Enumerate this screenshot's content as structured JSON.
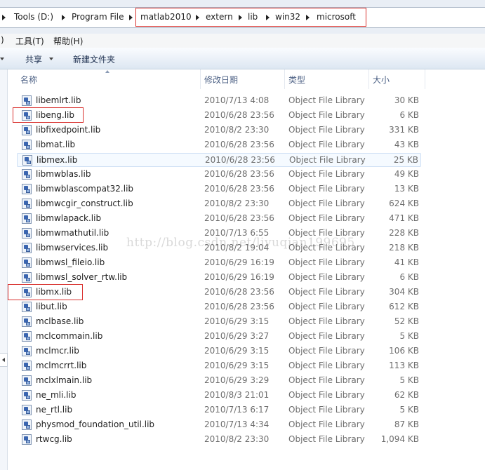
{
  "address_bar": {
    "crumbs": [
      "Tools (D:)",
      "Program File",
      "matlab2010",
      "extern",
      "lib",
      "win32",
      "microsoft"
    ]
  },
  "menu": {
    "items": [
      {
        "label": ")"
      },
      {
        "label": "工具(T)"
      },
      {
        "label": "帮助(H)"
      }
    ]
  },
  "toolbar": {
    "share_label": "共享",
    "new_folder_label": "新建文件夹"
  },
  "columns": {
    "name": "名称",
    "date": "修改日期",
    "type": "类型",
    "size": "大小"
  },
  "files": [
    {
      "name": "libemlrt.lib",
      "date": "2010/7/13 4:08",
      "type": "Object File Library",
      "size": "30 KB"
    },
    {
      "name": "libeng.lib",
      "date": "2010/6/28 23:56",
      "type": "Object File Library",
      "size": "6 KB"
    },
    {
      "name": "libfixedpoint.lib",
      "date": "2010/8/2 23:30",
      "type": "Object File Library",
      "size": "331 KB"
    },
    {
      "name": "libmat.lib",
      "date": "2010/6/28 23:56",
      "type": "Object File Library",
      "size": "43 KB"
    },
    {
      "name": "libmex.lib",
      "date": "2010/6/28 23:56",
      "type": "Object File Library",
      "size": "25 KB"
    },
    {
      "name": "libmwblas.lib",
      "date": "2010/6/28 23:56",
      "type": "Object File Library",
      "size": "49 KB"
    },
    {
      "name": "libmwblascompat32.lib",
      "date": "2010/6/28 23:56",
      "type": "Object File Library",
      "size": "13 KB"
    },
    {
      "name": "libmwcgir_construct.lib",
      "date": "2010/8/2 23:30",
      "type": "Object File Library",
      "size": "624 KB"
    },
    {
      "name": "libmwlapack.lib",
      "date": "2010/6/28 23:56",
      "type": "Object File Library",
      "size": "471 KB"
    },
    {
      "name": "libmwmathutil.lib",
      "date": "2010/7/13 6:55",
      "type": "Object File Library",
      "size": "228 KB"
    },
    {
      "name": "libmwservices.lib",
      "date": "2010/8/2 19:04",
      "type": "Object File Library",
      "size": "218 KB"
    },
    {
      "name": "libmwsl_fileio.lib",
      "date": "2010/6/29 16:19",
      "type": "Object File Library",
      "size": "41 KB"
    },
    {
      "name": "libmwsl_solver_rtw.lib",
      "date": "2010/6/29 16:19",
      "type": "Object File Library",
      "size": "6 KB"
    },
    {
      "name": "libmx.lib",
      "date": "2010/6/28 23:56",
      "type": "Object File Library",
      "size": "304 KB"
    },
    {
      "name": "libut.lib",
      "date": "2010/6/28 23:56",
      "type": "Object File Library",
      "size": "612 KB"
    },
    {
      "name": "mclbase.lib",
      "date": "2010/6/29 3:15",
      "type": "Object File Library",
      "size": "52 KB"
    },
    {
      "name": "mclcommain.lib",
      "date": "2010/6/29 3:27",
      "type": "Object File Library",
      "size": "5 KB"
    },
    {
      "name": "mclmcr.lib",
      "date": "2010/6/29 3:15",
      "type": "Object File Library",
      "size": "106 KB"
    },
    {
      "name": "mclmcrrt.lib",
      "date": "2010/6/29 3:15",
      "type": "Object File Library",
      "size": "113 KB"
    },
    {
      "name": "mclxlmain.lib",
      "date": "2010/6/29 3:29",
      "type": "Object File Library",
      "size": "5 KB"
    },
    {
      "name": "ne_mli.lib",
      "date": "2010/8/3 21:01",
      "type": "Object File Library",
      "size": "62 KB"
    },
    {
      "name": "ne_rtl.lib",
      "date": "2010/7/13 6:17",
      "type": "Object File Library",
      "size": "5 KB"
    },
    {
      "name": "physmod_foundation_util.lib",
      "date": "2010/7/13 4:34",
      "type": "Object File Library",
      "size": "87 KB"
    },
    {
      "name": "rtwcg.lib",
      "date": "2010/8/2 23:30",
      "type": "Object File Library",
      "size": "1,094 KB"
    }
  ],
  "watermark": "http://blog.csdn.net/liyuqian199695",
  "colors": {
    "annotation": "#d9322f",
    "header_text": "#4d6185",
    "hover_border": "#cfe0f5"
  },
  "icons": {
    "file": "library-file-icon",
    "crumb_separator": "chevron-right-icon"
  }
}
